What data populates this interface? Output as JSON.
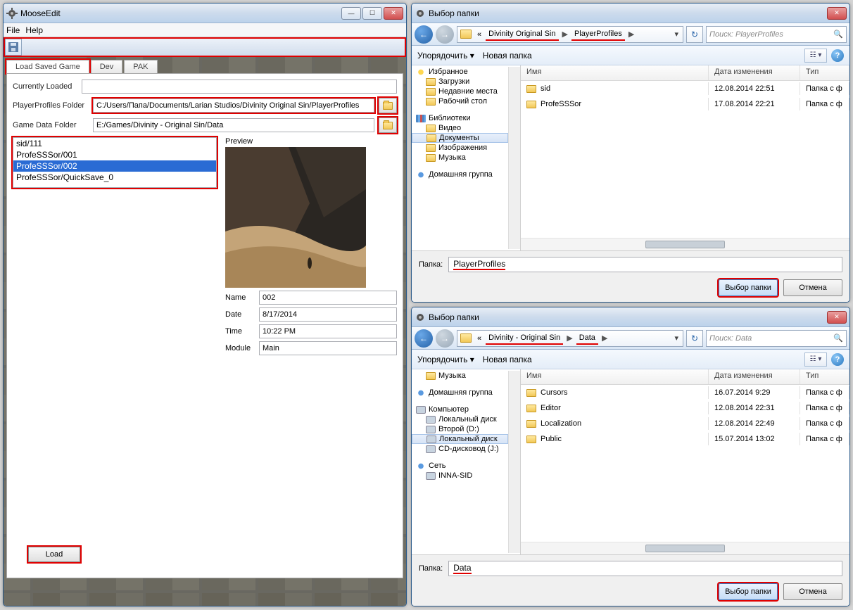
{
  "mooseedit": {
    "title": "MooseEdit",
    "menu": {
      "file": "File",
      "help": "Help"
    },
    "tabs": {
      "load": "Load Saved Game",
      "dev": "Dev",
      "pak": "PAK"
    },
    "currently_loaded_label": "Currently Loaded",
    "currently_loaded_value": "",
    "profiles_label": "PlayerProfiles Folder",
    "profiles_value": "C:/Users/Папа/Documents/Larian Studios/Divinity Original Sin/PlayerProfiles",
    "gamedata_label": "Game Data Folder",
    "gamedata_value": "E:/Games/Divinity - Original Sin/Data",
    "saves": {
      "s0": "sid/111",
      "s1": "ProfeSSSor/001",
      "s2": "ProfeSSSor/002",
      "s3": "ProfeSSSor/QuickSave_0"
    },
    "preview_label": "Preview",
    "name_lbl": "Name",
    "name_val": "002",
    "date_lbl": "Date",
    "date_val": "8/17/2014",
    "time_lbl": "Time",
    "time_val": "10:22 PM",
    "module_lbl": "Module",
    "module_val": "Main",
    "load_btn": "Load"
  },
  "dlg1": {
    "title": "Выбор папки",
    "bc_prefix": "«",
    "bc1": "Divinity Original Sin",
    "bc2": "PlayerProfiles",
    "bc_arrow": "▶",
    "search_placeholder": "Поиск: PlayerProfiles",
    "toolbar_org": "Упорядочить",
    "toolbar_new": "Новая папка",
    "tree": {
      "fav": "Избранное",
      "dl": "Загрузки",
      "recent": "Недавние места",
      "desk": "Рабочий стол",
      "lib": "Библиотеки",
      "vid": "Видео",
      "doc": "Документы",
      "img": "Изображения",
      "mus": "Музыка",
      "home": "Домашняя группа"
    },
    "col_name": "Имя",
    "col_date": "Дата изменения",
    "col_type": "Тип",
    "rows": {
      "r0": {
        "name": "sid",
        "date": "12.08.2014 22:51",
        "type": "Папка с ф"
      },
      "r1": {
        "name": "ProfeSSSor",
        "date": "17.08.2014 22:21",
        "type": "Папка с ф"
      }
    },
    "folder_lbl": "Папка:",
    "folder_val": "PlayerProfiles",
    "ok": "Выбор папки",
    "cancel": "Отмена"
  },
  "dlg2": {
    "title": "Выбор папки",
    "bc_prefix": "«",
    "bc1": "Divinity - Original Sin",
    "bc2": "Data",
    "bc_arrow": "▶",
    "search_placeholder": "Поиск: Data",
    "toolbar_org": "Упорядочить",
    "toolbar_new": "Новая папка",
    "tree": {
      "mus": "Музыка",
      "home": "Домашняя группа",
      "comp": "Компьютер",
      "drv_c": "Локальный диск",
      "drv_d": "Второй (D:)",
      "drv_e": "Локальный диск",
      "drv_j": "CD-дисковод (J:)",
      "net": "Сеть",
      "inna": "INNA-SID"
    },
    "col_name": "Имя",
    "col_date": "Дата изменения",
    "col_type": "Тип",
    "rows": {
      "r0": {
        "name": "Cursors",
        "date": "16.07.2014 9:29",
        "type": "Папка с ф"
      },
      "r1": {
        "name": "Editor",
        "date": "12.08.2014 22:31",
        "type": "Папка с ф"
      },
      "r2": {
        "name": "Localization",
        "date": "12.08.2014 22:49",
        "type": "Папка с ф"
      },
      "r3": {
        "name": "Public",
        "date": "15.07.2014 13:02",
        "type": "Папка с ф"
      }
    },
    "folder_lbl": "Папка:",
    "folder_val": "Data",
    "ok": "Выбор папки",
    "cancel": "Отмена"
  }
}
